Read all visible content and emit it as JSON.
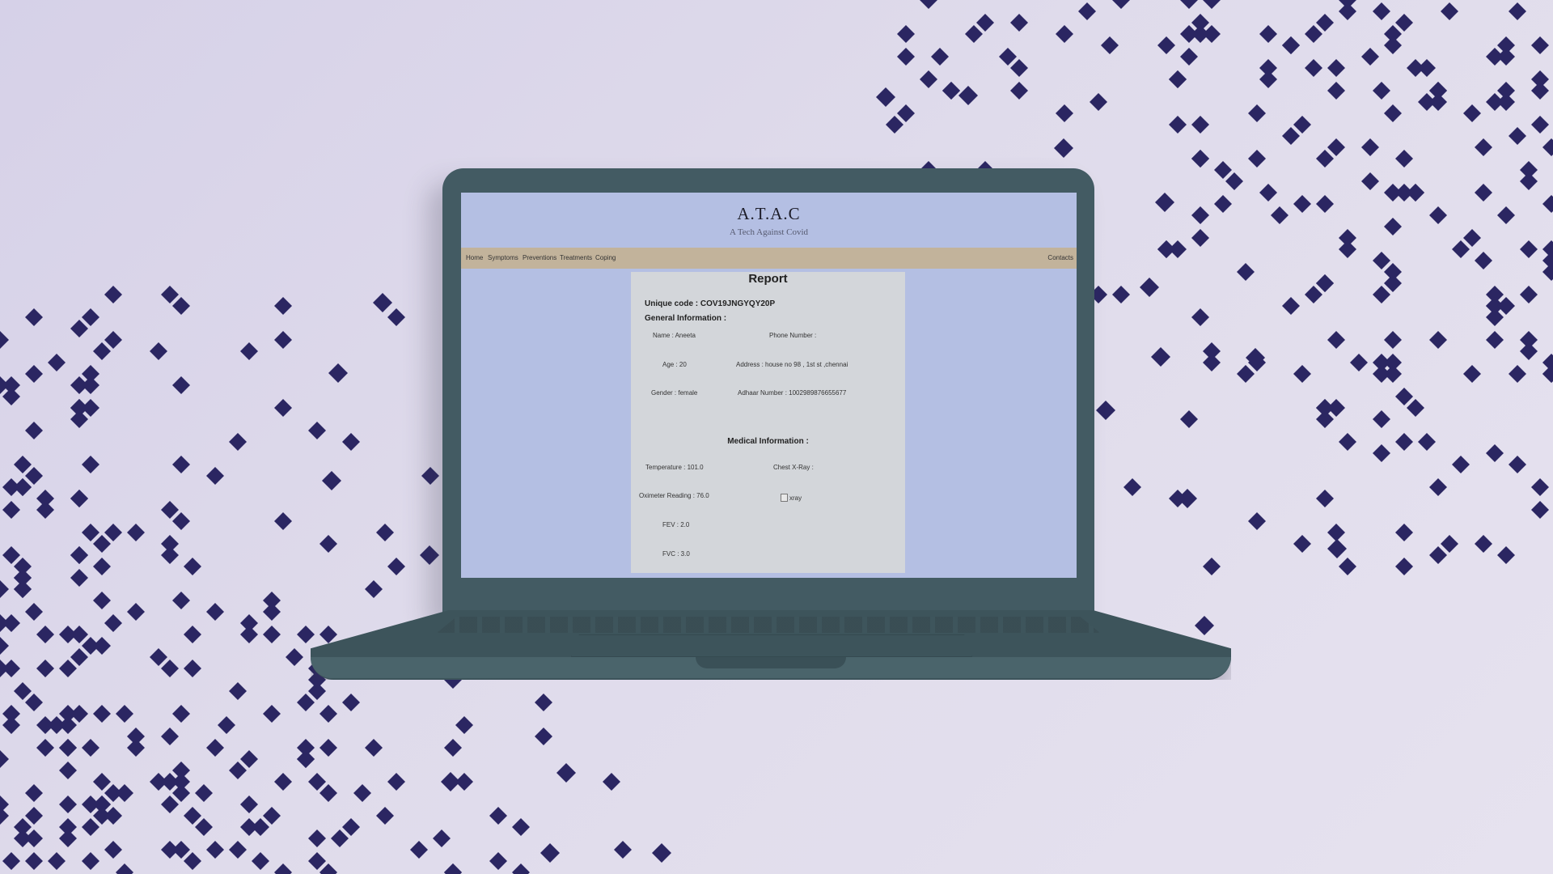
{
  "site": {
    "title": "A.T.A.C",
    "subtitle": "A Tech Against Covid"
  },
  "nav": {
    "items": [
      "Home",
      "Symptoms",
      "Preventions",
      "Treatments",
      "Coping"
    ],
    "right_item": "Contacts"
  },
  "report": {
    "title": "Report",
    "unique_code": "Unique code : COV19JNGYQY20P",
    "general_heading": "General Information :",
    "general": {
      "name": "Name : Aneeta",
      "phone": "Phone Number :",
      "age": "Age : 20",
      "address": "Address : house no 98 , 1st st ,chennai",
      "gender": "Gender : female",
      "adhaar": "Adhaar Number : 1002989876655677"
    },
    "medical_heading": "Medical Information :",
    "medical": {
      "temperature": "Temperature : 101.0",
      "chest_xray": "Chest X-Ray :",
      "oximeter": "Oximeter Reading : 76.0",
      "xray_alt": "xray",
      "fev": "FEV : 2.0",
      "fvc": "FVC : 3.0"
    }
  },
  "colors": {
    "background": "#dcd8ea",
    "pixel_accent": "#2b2662",
    "laptop_body": "#435b63",
    "screen_background": "#b4bfe3",
    "navbar": "#c2b39b",
    "report_card": "#d3d6da"
  }
}
